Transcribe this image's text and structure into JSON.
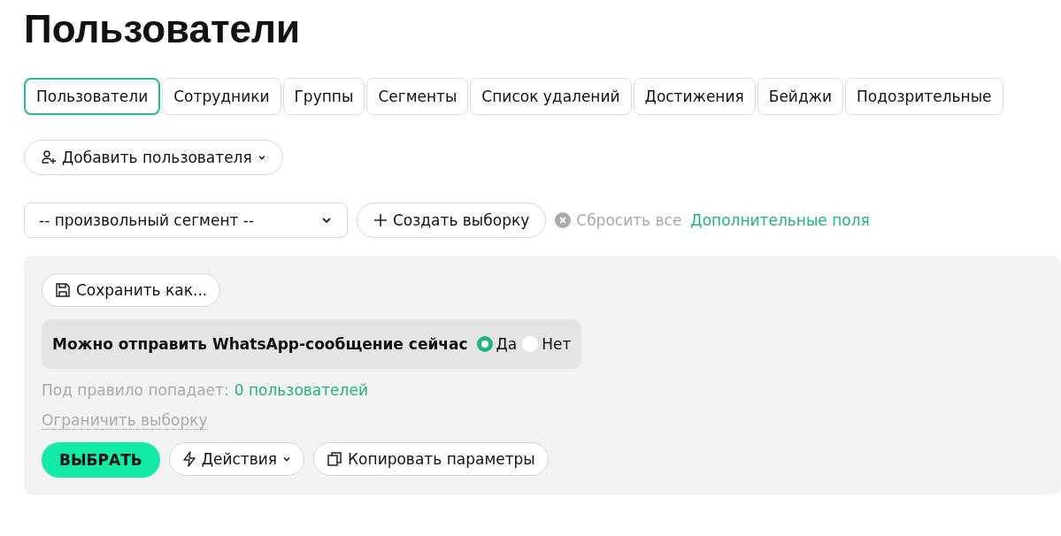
{
  "title": "Пользователи",
  "tabs": [
    {
      "label": "Пользователи",
      "selected": true
    },
    {
      "label": "Сотрудники",
      "selected": false
    },
    {
      "label": "Группы",
      "selected": false
    },
    {
      "label": "Сегменты",
      "selected": false
    },
    {
      "label": "Список удалений",
      "selected": false
    },
    {
      "label": "Достижения",
      "selected": false
    },
    {
      "label": "Бейджи",
      "selected": false
    },
    {
      "label": "Подозрительные",
      "selected": false
    }
  ],
  "add_user_button": "Добавить пользователя",
  "filters": {
    "segment_select": "-- произвольный сегмент --",
    "create_button": "Создать выборку",
    "reset_link": "Сбросить все",
    "extra_fields_link": "Дополнительные поля"
  },
  "panel": {
    "save_button": "Сохранить как...",
    "rule": {
      "label": "Можно отправить WhatsApp-сообщение сейчас",
      "options": [
        {
          "label": "Да",
          "selected": true
        },
        {
          "label": "Нет",
          "selected": false
        }
      ]
    },
    "match_text": "Под правило попадает:",
    "match_count": "0 пользователей",
    "limit_link": "Ограничить выборку",
    "select_button": "ВЫБРАТЬ",
    "actions_button": "Действия",
    "copy_button": "Копировать параметры"
  }
}
